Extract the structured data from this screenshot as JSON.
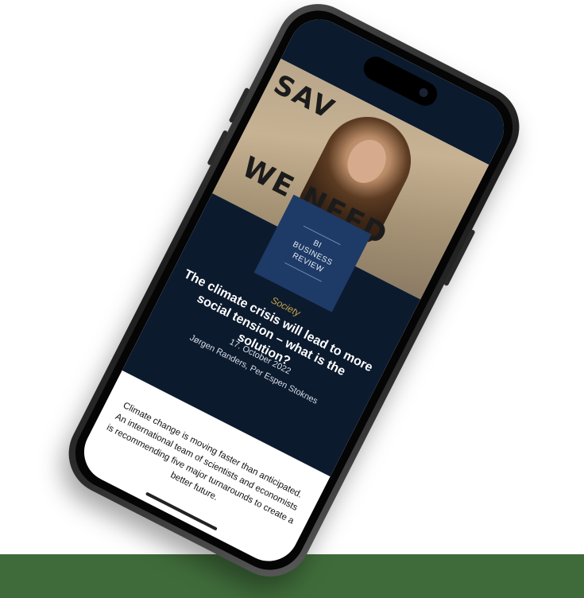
{
  "hero": {
    "sign_top": "SAV",
    "sign_bottom": "WE NEED"
  },
  "logo": {
    "line1": "BI",
    "line2": "BUSINESS",
    "line3": "REVIEW"
  },
  "article": {
    "category": "Society",
    "title": "The climate crisis will lead to more social tension – what is the solution?",
    "date": "17. October 2022",
    "authors": "Jørgen Randers, Per Espen Stoknes",
    "lead": "Climate change is moving faster than anticipated. An international team of scientists and economists is recommending five major turnarounds to create a better future."
  },
  "colors": {
    "nav_bg": "#0c1a2e",
    "logo_bg": "#1e3a66",
    "category": "#c9a64a",
    "band": "#3f6b3a"
  }
}
